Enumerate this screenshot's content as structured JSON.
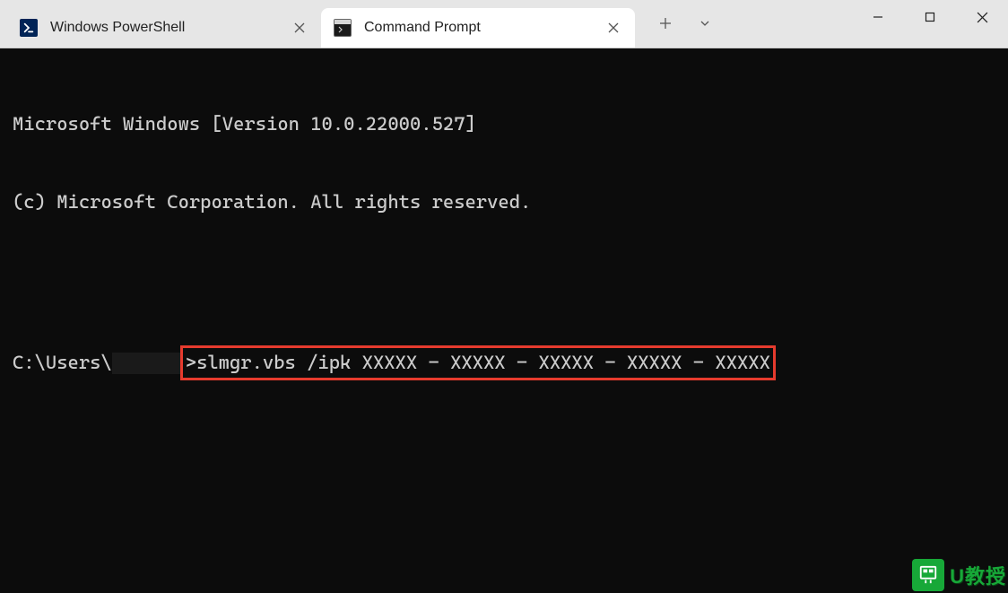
{
  "tabs": {
    "powershell": {
      "label": "Windows PowerShell"
    },
    "cmd": {
      "label": "Command Prompt"
    }
  },
  "terminal": {
    "line1": "Microsoft Windows [Version 10.0.22000.527]",
    "line2": "(c) Microsoft Corporation. All rights reserved.",
    "prompt_prefix": "C:\\Users\\",
    "prompt_suffix": ">",
    "command": "slmgr.vbs /ipk XXXXX - XXXXX - XXXXX - XXXXX - XXXXX"
  },
  "watermark": {
    "text": "U教授"
  }
}
